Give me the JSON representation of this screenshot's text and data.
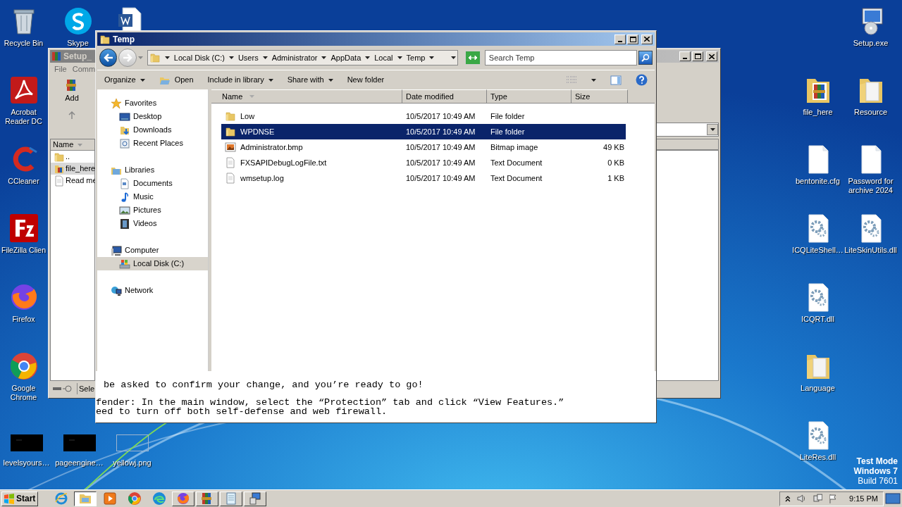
{
  "desktop": {
    "left_column": [
      {
        "label": "Recycle Bin",
        "kind": "recycle"
      },
      {
        "label": "Acrobat Reader DC",
        "kind": "acrobat"
      },
      {
        "label": "CCleaner",
        "kind": "ccleaner"
      },
      {
        "label": "FileZilla Clien",
        "kind": "filezilla"
      },
      {
        "label": "Firefox",
        "kind": "firefox"
      },
      {
        "label": "Google Chrome",
        "kind": "chrome"
      }
    ],
    "top_row": [
      {
        "label": "Skype",
        "kind": "skype"
      },
      {
        "kind": "word"
      }
    ],
    "bottom_row": [
      {
        "label": "levelsyours…",
        "kind": "thumb"
      },
      {
        "label": "pageengine…",
        "kind": "thumb"
      },
      {
        "label": "yellowj.png",
        "kind": "image"
      }
    ],
    "right_column_a": [
      {
        "label": "file_here",
        "kind": "archive-folder"
      },
      {
        "label": "bentonite.cfg",
        "kind": "file"
      },
      {
        "label": "ICQLiteShell…",
        "kind": "dll"
      },
      {
        "label": "ICQRT.dll",
        "kind": "dll"
      },
      {
        "label": "Language",
        "kind": "docs-folder"
      },
      {
        "label": "LiteRes.dll",
        "kind": "dll"
      }
    ],
    "right_column_b": [
      {
        "label": "Setup.exe",
        "kind": "setup"
      },
      {
        "label": "Resource",
        "kind": "docs-folder"
      },
      {
        "label": "Password for archive 2024",
        "kind": "file"
      },
      {
        "label": "LiteSkinUtils.dll",
        "kind": "dll"
      }
    ],
    "os_notice": [
      "Test Mode",
      "Windows 7",
      "Build 7601"
    ]
  },
  "archive_window": {
    "title": "Setup_",
    "menu": [
      "File",
      "Comm"
    ],
    "toolbar": [
      "Add"
    ],
    "column": "Name",
    "rows": [
      {
        "name": "..",
        "kind": "folder",
        "selected": false
      },
      {
        "name": "file_here",
        "kind": "archive-folder",
        "selected": true
      },
      {
        "name": "Read me",
        "kind": "file",
        "selected": false
      }
    ],
    "status": "Sele"
  },
  "explorer": {
    "title": "Temp",
    "breadcrumbs": [
      "Local Disk (C:)",
      "Users",
      "Administrator",
      "AppData",
      "Local",
      "Temp"
    ],
    "search": {
      "placeholder": "Search Temp"
    },
    "toolbar": [
      {
        "label": "Organize",
        "dropdown": true,
        "kind": "plain"
      },
      {
        "label": "Open",
        "dropdown": false,
        "kind": "open"
      },
      {
        "label": "Include in library",
        "dropdown": true,
        "kind": "plain"
      },
      {
        "label": "Share with",
        "dropdown": true,
        "kind": "plain"
      },
      {
        "label": "New folder",
        "dropdown": false,
        "kind": "plain"
      }
    ],
    "nav": [
      {
        "label": "Favorites",
        "kind": "star",
        "children": [
          {
            "label": "Desktop",
            "kind": "desktop",
            "selected": false
          },
          {
            "label": "Downloads",
            "kind": "downloads",
            "selected": false
          },
          {
            "label": "Recent Places",
            "kind": "recent",
            "selected": false
          }
        ]
      },
      {
        "label": "Libraries",
        "kind": "libraries",
        "children": [
          {
            "label": "Documents",
            "kind": "documents",
            "selected": false
          },
          {
            "label": "Music",
            "kind": "music",
            "selected": false
          },
          {
            "label": "Pictures",
            "kind": "pictures",
            "selected": false
          },
          {
            "label": "Videos",
            "kind": "videos",
            "selected": false
          }
        ]
      },
      {
        "label": "Computer",
        "kind": "computer",
        "children": [
          {
            "label": "Local Disk (C:)",
            "kind": "disk",
            "selected": true
          }
        ]
      },
      {
        "label": "Network",
        "kind": "network"
      }
    ],
    "columns": [
      "Name",
      "Date modified",
      "Type",
      "Size"
    ],
    "files": [
      {
        "name": "Low",
        "date": "10/5/2017 10:49 AM",
        "type": "File folder",
        "kind": "folder",
        "selected": false
      },
      {
        "name": "WPDNSE",
        "date": "10/5/2017 10:49 AM",
        "type": "File folder",
        "kind": "folder",
        "selected": true
      },
      {
        "name": "Administrator.bmp",
        "date": "10/5/2017 10:49 AM",
        "type": "Bitmap image",
        "size": "49 KB",
        "kind": "bitmap",
        "selected": false
      },
      {
        "name": "FXSAPIDebugLogFile.txt",
        "date": "10/5/2017 10:49 AM",
        "type": "Text Document",
        "size": "0 KB",
        "kind": "text",
        "selected": false
      },
      {
        "name": "wmsetup.log",
        "date": "10/5/2017 10:49 AM",
        "type": "Text Document",
        "size": "1 KB",
        "kind": "text",
        "selected": false
      }
    ],
    "text_lines": [
      "be asked to confirm your change, and you’re ready to go!",
      "fender: In the main window, select the “Protection” tab and click “View Features.”",
      "eed to turn off both self-defense and web firewall."
    ]
  },
  "taskbar": {
    "start": "Start",
    "apps": [
      {
        "kind": "ie",
        "window_open": false,
        "selected": false
      },
      {
        "kind": "explorer",
        "window_open": true,
        "selected": true
      },
      {
        "kind": "media",
        "window_open": false,
        "selected": false
      },
      {
        "kind": "chrome",
        "window_open": false,
        "selected": false
      },
      {
        "kind": "edge",
        "window_open": false,
        "selected": false
      },
      {
        "kind": "firefox",
        "window_open": true,
        "selected": false
      },
      {
        "kind": "winrar",
        "window_open": true,
        "selected": false
      },
      {
        "kind": "notepad",
        "window_open": true,
        "selected": false
      },
      {
        "kind": "setup",
        "window_open": true,
        "selected": false
      }
    ],
    "time": "9:15 PM"
  }
}
